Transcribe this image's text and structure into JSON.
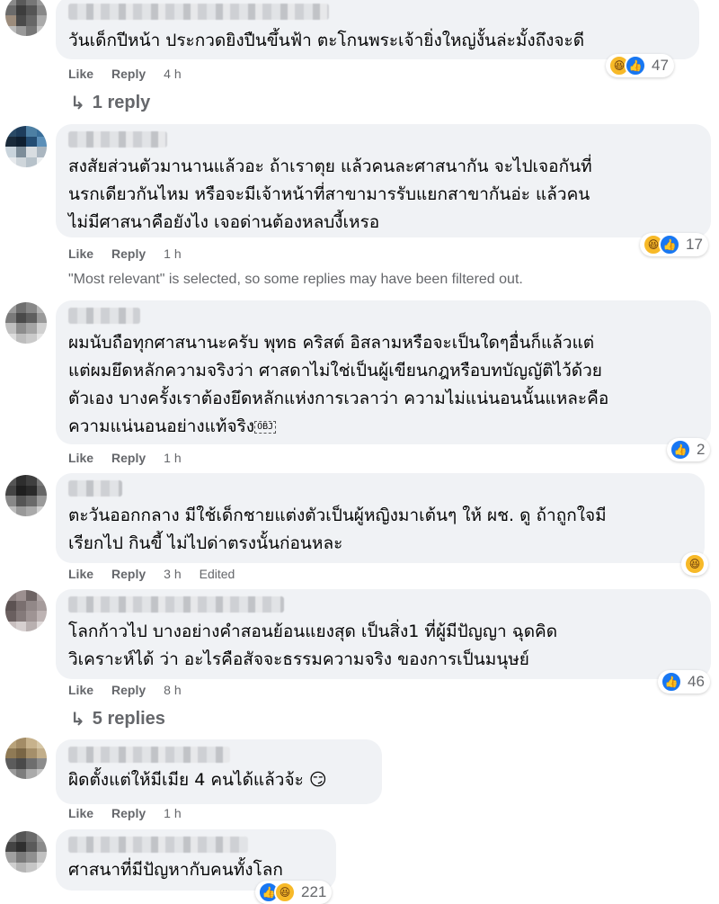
{
  "actions": {
    "like": "Like",
    "reply": "Reply",
    "edited": "Edited"
  },
  "notice": "\"Most relevant\" is selected, so some replies may have been filtered out.",
  "comments": [
    {
      "text": "วันเด็กปีหน้า ประกวดยิงปืนขึ้นฟ้า ตะโกนพระเจ้ายิ่งใหญ่งั้นล่ะมั้งถึงจะดี",
      "time": "4 h",
      "reactions": [
        "haha",
        "like"
      ],
      "count": "47",
      "replies_link": "1 reply"
    },
    {
      "text": "สงสัยส่วนตัวมานานแล้วอะ ถ้าเราตุย แล้วคนละศาสนากัน จะไปเจอกันที่\nนรกเดียวกันไหม หรือจะมีเจ้าหน้าที่สาขามารรับแยกสาขากันอ่ะ แล้วคน\nไม่มีศาสนาคือยังไง เจอด่านต้องหลบงี้เหรอ",
      "time": "1 h",
      "reactions": [
        "haha",
        "like"
      ],
      "count": "17"
    },
    {
      "text": "ผมนับถือทุกศาสนานะครับ พุทธ คริสต์ อิสลามหรือจะเป็นใดๆอื่นก็แล้วแต่\nแต่ผมยึดหลักความจริงว่า ศาสดาไม่ใช่เป็นผู้เขียนกฎหรือบทบัญญัติไว้ด้วย\nตัวเอง บางครั้งเราต้องยึดหลักแห่งการเวลาว่า ความไม่แน่นอนนั้นแหละคือ\nความแน่นอนอย่างแท้จริง",
      "obj": "OBJ",
      "time": "1 h",
      "reactions": [
        "like"
      ],
      "count": "2"
    },
    {
      "text": "ตะวันออกกลาง มีใช้เด็กชายแต่งตัวเป็นผู้หญิงมาเต้นๆ ให้ ผช. ดู ถ้าถูกใจมี\nเรียกไป กินขี้ ไม่ไปด่าตรงนั้นก่อนหละ",
      "time": "3 h",
      "edited": true,
      "reactions": [
        "haha"
      ],
      "count": ""
    },
    {
      "text": "โลกก้าวไป บางอย่างคำสอนย้อนแยงสุด เป็นสิ่ง1 ที่ผู้มีปัญญา ฉุดคิด\nวิเคราะห์ได้ ว่า อะไรคือสัจจะธรรมความจริง ของการเป็นมนุษย์",
      "time": "8 h",
      "reactions": [
        "like"
      ],
      "count": "46",
      "replies_link": "5 replies"
    },
    {
      "text": "ผิดตั้งแต่ให้มีเมีย 4 คนได้แล้วจ้ะ 😏",
      "time": "1 h"
    },
    {
      "text": "ศาสนาที่มีปัญหากับคนทั้งโลก",
      "reactions": [
        "like",
        "haha"
      ],
      "count": "221"
    }
  ]
}
